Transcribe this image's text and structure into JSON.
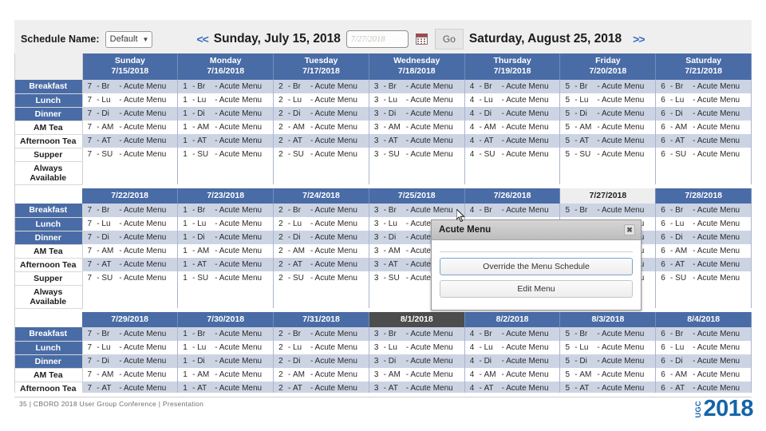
{
  "toolbar": {
    "schedule_name_label": "Schedule Name:",
    "schedule_name_value": "Default",
    "prev_arrow": "<<",
    "start_date": "Sunday, July 15, 2018",
    "date_input_value": "7/27/2018",
    "date_input_placeholder": "7/27/2018",
    "go_label": "Go",
    "end_date": "Saturday, August 25, 2018",
    "next_arrow": ">>",
    "calendar_icon": "calendar-icon",
    "caret_icon": "chevron-down-icon"
  },
  "grid": {
    "day_names": [
      "Sunday",
      "Monday",
      "Tuesday",
      "Wednesday",
      "Thursday",
      "Friday",
      "Saturday"
    ],
    "day_numbers": [
      "7",
      "1",
      "2",
      "3",
      "4",
      "5",
      "6"
    ],
    "meal_rows": [
      {
        "label": "Breakfast",
        "code": "Br",
        "style": "blue"
      },
      {
        "label": "Lunch",
        "code": "Lu",
        "style": "blue"
      },
      {
        "label": "Dinner",
        "code": "Di",
        "style": "blue"
      },
      {
        "label": "AM Tea",
        "code": "AM",
        "style": "white"
      },
      {
        "label": "Afternoon Tea",
        "code": "AT",
        "style": "white"
      },
      {
        "label": "Supper",
        "code": "SU",
        "style": "white"
      }
    ],
    "always_available_label": "Always Available",
    "menu_name": "Acute Menu",
    "separator": "-",
    "weeks": [
      {
        "dates": [
          "7/15/2018",
          "7/16/2018",
          "7/17/2018",
          "7/18/2018",
          "7/19/2018",
          "7/20/2018",
          "7/21/2018"
        ],
        "selected_index": -1,
        "hover_index": -1
      },
      {
        "dates": [
          "7/22/2018",
          "7/23/2018",
          "7/24/2018",
          "7/25/2018",
          "7/26/2018",
          "7/27/2018",
          "7/28/2018"
        ],
        "selected_index": 5,
        "hover_index": -1
      },
      {
        "dates": [
          "7/29/2018",
          "7/30/2018",
          "7/31/2018",
          "8/1/2018",
          "8/2/2018",
          "8/3/2018",
          "8/4/2018"
        ],
        "selected_index": -1,
        "hover_index": 3
      }
    ]
  },
  "popup": {
    "title": "Acute Menu",
    "close_label": "✖",
    "override_label": "Override the Menu Schedule",
    "edit_label": "Edit Menu"
  },
  "footer": {
    "text": "35 | CBORD 2018 User Group Conference | Presentation",
    "logo_mark": "UGC",
    "logo_year": "2018"
  }
}
